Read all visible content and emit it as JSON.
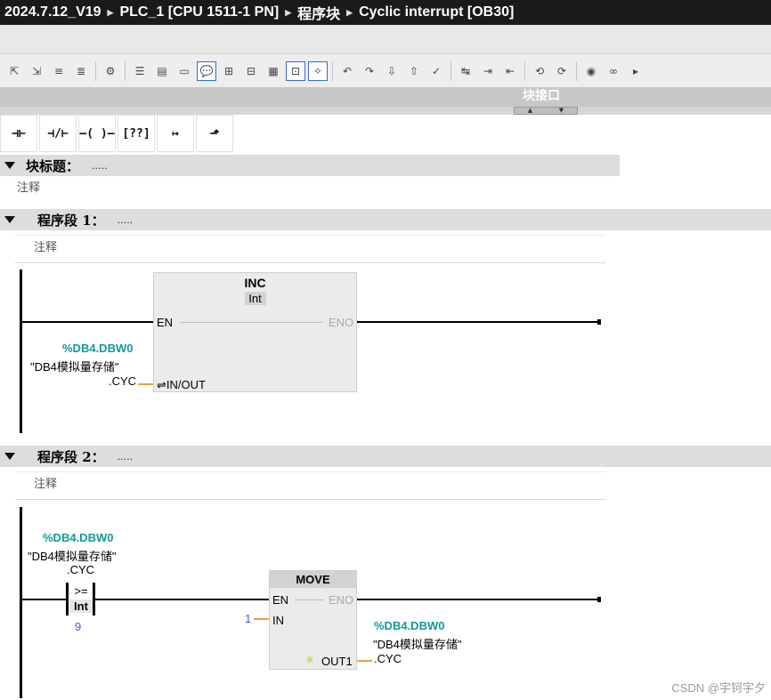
{
  "breadcrumb": [
    "2024.7.12_V19",
    "PLC_1 [CPU 1511-1 PN]",
    "程序块",
    "Cyclic interrupt [OB30]"
  ],
  "interface_label": "块接口",
  "ladder_buttons": [
    {
      "name": "no-contact-icon",
      "glyph": "⊣⊢"
    },
    {
      "name": "nc-contact-icon",
      "glyph": "⊣/⊢"
    },
    {
      "name": "coil-icon",
      "glyph": "–( )–"
    },
    {
      "name": "empty-box-icon",
      "glyph": "[??]"
    },
    {
      "name": "open-branch-icon",
      "glyph": "↦"
    },
    {
      "name": "close-branch-icon",
      "glyph": "⬏"
    }
  ],
  "block": {
    "title": "块标题：",
    "dots": ".....",
    "comment": "注释"
  },
  "networks": [
    {
      "title": "程序段 1：",
      "dots": ".....",
      "comment": "注释",
      "instr": {
        "name": "INC",
        "type": "Int",
        "en": "EN",
        "eno": "ENO",
        "inout": "⇌IN/OUT"
      },
      "operand": {
        "address": "%DB4.DBW0",
        "symbol": "\"DB4模拟量存储\"",
        "member": ".CYC"
      }
    },
    {
      "title": "程序段 2：",
      "dots": ".....",
      "comment": "注释",
      "compare": {
        "op": ">=",
        "type": "Int",
        "value": "9"
      },
      "compare_operand": {
        "address": "%DB4.DBW0",
        "symbol": "\"DB4模拟量存储\"",
        "member": ".CYC"
      },
      "instr": {
        "name": "MOVE",
        "en": "EN",
        "eno": "ENO",
        "in": "IN",
        "out": "OUT1",
        "in_value": "1"
      },
      "out_operand": {
        "address": "%DB4.DBW0",
        "symbol": "\"DB4模拟量存储\"",
        "member": ".CYC"
      }
    }
  ],
  "watermark": "CSDN @宇钶宇夕"
}
